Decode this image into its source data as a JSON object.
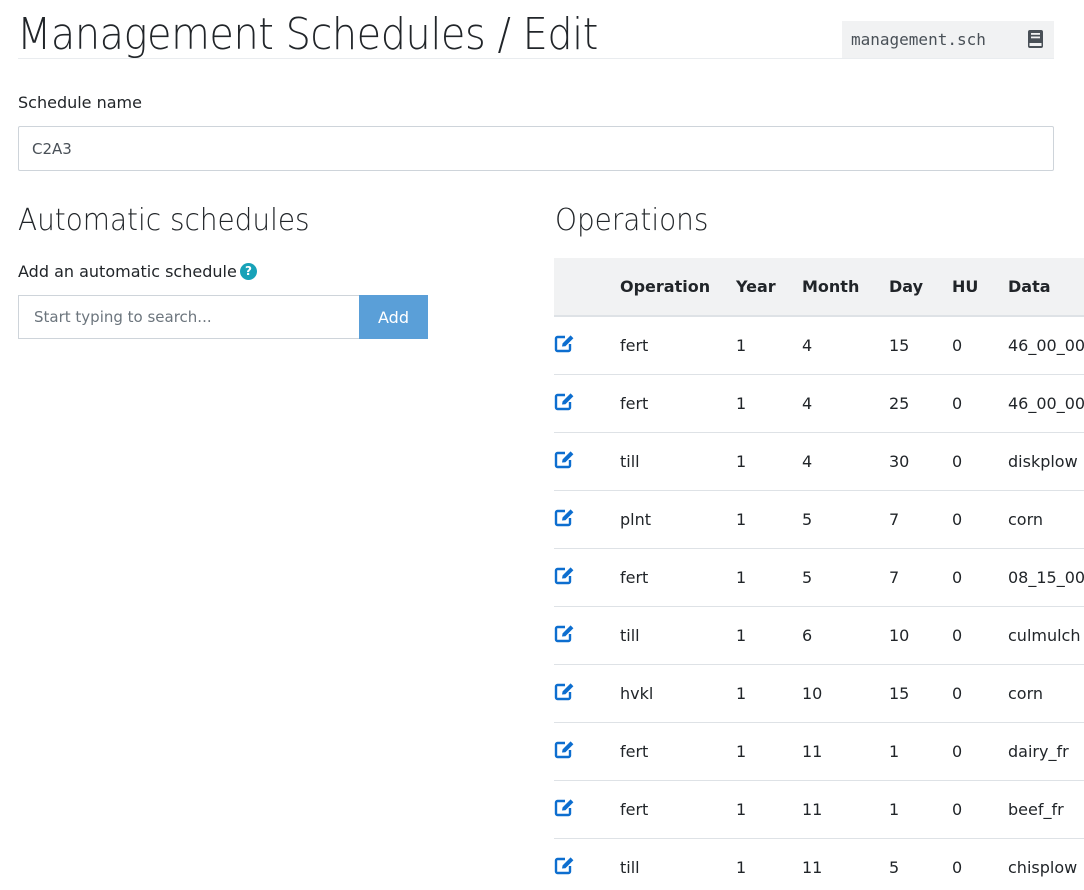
{
  "header": {
    "title": "Management Schedules / Edit",
    "file_name": "management.sch",
    "file_icon": "book-icon"
  },
  "schedule_name": {
    "label": "Schedule name",
    "value": "C2A3"
  },
  "automatic": {
    "title": "Automatic schedules",
    "add_label": "Add an automatic schedule",
    "help_icon": "question-circle-icon",
    "search_placeholder": "Start typing to search...",
    "add_button": "Add"
  },
  "operations": {
    "title": "Operations",
    "columns": [
      "",
      "Operation",
      "Year",
      "Month",
      "Day",
      "HU",
      "Data"
    ],
    "row_icon": "edit-icon",
    "rows": [
      {
        "operation": "fert",
        "year": "1",
        "month": "4",
        "day": "15",
        "hu": "0",
        "data": "46_00_00"
      },
      {
        "operation": "fert",
        "year": "1",
        "month": "4",
        "day": "25",
        "hu": "0",
        "data": "46_00_00"
      },
      {
        "operation": "till",
        "year": "1",
        "month": "4",
        "day": "30",
        "hu": "0",
        "data": "diskplow"
      },
      {
        "operation": "plnt",
        "year": "1",
        "month": "5",
        "day": "7",
        "hu": "0",
        "data": "corn"
      },
      {
        "operation": "fert",
        "year": "1",
        "month": "5",
        "day": "7",
        "hu": "0",
        "data": "08_15_00"
      },
      {
        "operation": "till",
        "year": "1",
        "month": "6",
        "day": "10",
        "hu": "0",
        "data": "culmulch"
      },
      {
        "operation": "hvkl",
        "year": "1",
        "month": "10",
        "day": "15",
        "hu": "0",
        "data": "corn"
      },
      {
        "operation": "fert",
        "year": "1",
        "month": "11",
        "day": "1",
        "hu": "0",
        "data": "dairy_fr"
      },
      {
        "operation": "fert",
        "year": "1",
        "month": "11",
        "day": "1",
        "hu": "0",
        "data": "beef_fr"
      },
      {
        "operation": "till",
        "year": "1",
        "month": "11",
        "day": "5",
        "hu": "0",
        "data": "chisplow"
      }
    ]
  },
  "colors": {
    "accent": "#5a9fd8",
    "edit_icon": "#0d6ecf",
    "help_icon": "#17a2b8",
    "table_header_bg": "#f1f2f3"
  }
}
